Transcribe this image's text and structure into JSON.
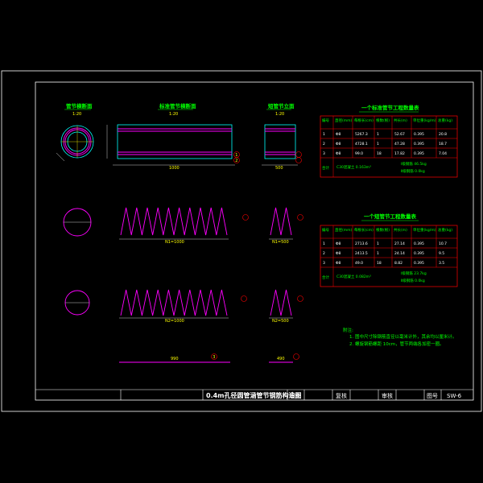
{
  "drawing": {
    "title": "0.4m孔径圆管涵管节钢筋构造图",
    "sheet_no_label": "图号",
    "sheet_no": "SW-6",
    "design_label": "设计",
    "review_label": "复核",
    "audit_label": "审核"
  },
  "views": {
    "section_title": "管节横断面",
    "section_scale": "1:20",
    "standard_title": "标准管节横断面",
    "standard_scale": "1:20",
    "short_title": "短管节立面",
    "short_scale": "1:20",
    "standard_length": "1000",
    "short_length": "500",
    "plan_len_1": "N1=1000",
    "plan_len_2": "N2=1000",
    "plan_len_3": "N1=500",
    "plan_len_4": "N2=500",
    "straight_1": "990",
    "straight_2": "490"
  },
  "markers": [
    "1",
    "2",
    "3"
  ],
  "table1": {
    "title": "一个标准管节工程数量表",
    "headers": [
      "编号",
      "直径(mm)",
      "每根长(cm)",
      "根数(根)",
      "共长(m)",
      "单位重(kg/m)",
      "总重(kg)"
    ],
    "rows": [
      [
        "1",
        "Φ8",
        "5267.3",
        "1",
        "52.67",
        "0.395",
        "20.8"
      ],
      [
        "2",
        "Φ8",
        "4728.1",
        "1",
        "47.28",
        "0.395",
        "18.7"
      ],
      [
        "3",
        "Φ8",
        "99.0",
        "18",
        "17.82",
        "0.395",
        "7.04"
      ]
    ],
    "total_label": "合计",
    "total_concrete": "C30混凝土 0.163m³",
    "total_steel_a": "Ⅰ级钢筋 46.5kg",
    "total_steel_b": "Ⅱ级钢筋 0.0kg"
  },
  "table2": {
    "title": "一个短管节工程数量表",
    "headers": [
      "编号",
      "直径(mm)",
      "每根长(cm)",
      "根数(根)",
      "共长(m)",
      "单位重(kg/m)",
      "总重(kg)"
    ],
    "rows": [
      [
        "1",
        "Φ8",
        "2713.6",
        "1",
        "27.14",
        "0.395",
        "10.7"
      ],
      [
        "2",
        "Φ8",
        "2413.5",
        "1",
        "24.14",
        "0.395",
        "9.5"
      ],
      [
        "3",
        "Φ8",
        "49.0",
        "18",
        "8.82",
        "0.395",
        "3.5"
      ]
    ],
    "total_label": "合计",
    "total_concrete": "C30混凝土 0.082m³",
    "total_steel_a": "Ⅰ级钢筋 23.7kg",
    "total_steel_b": "Ⅱ级钢筋 0.0kg"
  },
  "notes": {
    "heading": "附注:",
    "line1": "1. 图中尺寸除钢筋直径以毫米计外，其余均以厘米计。",
    "line2": "2. 螺旋钢筋螺距 10cm，管节两端各加密一圈。"
  },
  "colors": {
    "frame": "#ffffff",
    "dim": "#ffff00",
    "rebar": "#ff00ff",
    "concrete": "#00ffff",
    "label": "#00ff00",
    "marker": "#ff0000"
  }
}
